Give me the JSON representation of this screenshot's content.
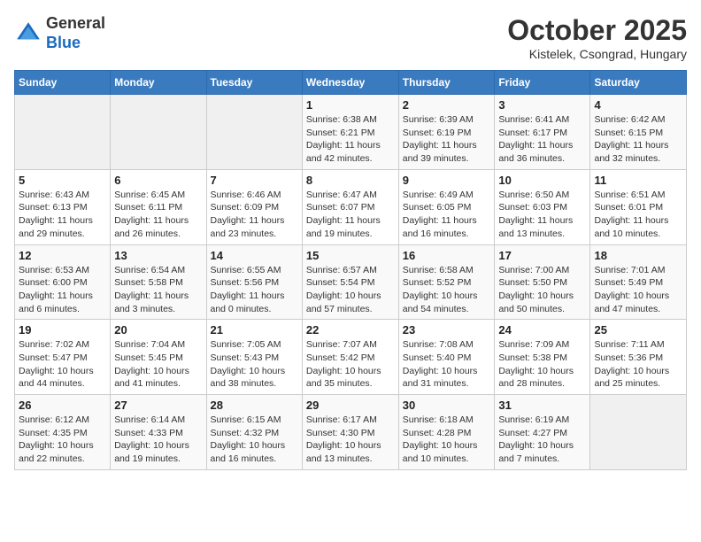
{
  "header": {
    "logo_line1": "General",
    "logo_line2": "Blue",
    "month_title": "October 2025",
    "location": "Kistelek, Csongrad, Hungary"
  },
  "weekdays": [
    "Sunday",
    "Monday",
    "Tuesday",
    "Wednesday",
    "Thursday",
    "Friday",
    "Saturday"
  ],
  "weeks": [
    [
      {
        "day": "",
        "info": ""
      },
      {
        "day": "",
        "info": ""
      },
      {
        "day": "",
        "info": ""
      },
      {
        "day": "1",
        "info": "Sunrise: 6:38 AM\nSunset: 6:21 PM\nDaylight: 11 hours\nand 42 minutes."
      },
      {
        "day": "2",
        "info": "Sunrise: 6:39 AM\nSunset: 6:19 PM\nDaylight: 11 hours\nand 39 minutes."
      },
      {
        "day": "3",
        "info": "Sunrise: 6:41 AM\nSunset: 6:17 PM\nDaylight: 11 hours\nand 36 minutes."
      },
      {
        "day": "4",
        "info": "Sunrise: 6:42 AM\nSunset: 6:15 PM\nDaylight: 11 hours\nand 32 minutes."
      }
    ],
    [
      {
        "day": "5",
        "info": "Sunrise: 6:43 AM\nSunset: 6:13 PM\nDaylight: 11 hours\nand 29 minutes."
      },
      {
        "day": "6",
        "info": "Sunrise: 6:45 AM\nSunset: 6:11 PM\nDaylight: 11 hours\nand 26 minutes."
      },
      {
        "day": "7",
        "info": "Sunrise: 6:46 AM\nSunset: 6:09 PM\nDaylight: 11 hours\nand 23 minutes."
      },
      {
        "day": "8",
        "info": "Sunrise: 6:47 AM\nSunset: 6:07 PM\nDaylight: 11 hours\nand 19 minutes."
      },
      {
        "day": "9",
        "info": "Sunrise: 6:49 AM\nSunset: 6:05 PM\nDaylight: 11 hours\nand 16 minutes."
      },
      {
        "day": "10",
        "info": "Sunrise: 6:50 AM\nSunset: 6:03 PM\nDaylight: 11 hours\nand 13 minutes."
      },
      {
        "day": "11",
        "info": "Sunrise: 6:51 AM\nSunset: 6:01 PM\nDaylight: 11 hours\nand 10 minutes."
      }
    ],
    [
      {
        "day": "12",
        "info": "Sunrise: 6:53 AM\nSunset: 6:00 PM\nDaylight: 11 hours\nand 6 minutes."
      },
      {
        "day": "13",
        "info": "Sunrise: 6:54 AM\nSunset: 5:58 PM\nDaylight: 11 hours\nand 3 minutes."
      },
      {
        "day": "14",
        "info": "Sunrise: 6:55 AM\nSunset: 5:56 PM\nDaylight: 11 hours\nand 0 minutes."
      },
      {
        "day": "15",
        "info": "Sunrise: 6:57 AM\nSunset: 5:54 PM\nDaylight: 10 hours\nand 57 minutes."
      },
      {
        "day": "16",
        "info": "Sunrise: 6:58 AM\nSunset: 5:52 PM\nDaylight: 10 hours\nand 54 minutes."
      },
      {
        "day": "17",
        "info": "Sunrise: 7:00 AM\nSunset: 5:50 PM\nDaylight: 10 hours\nand 50 minutes."
      },
      {
        "day": "18",
        "info": "Sunrise: 7:01 AM\nSunset: 5:49 PM\nDaylight: 10 hours\nand 47 minutes."
      }
    ],
    [
      {
        "day": "19",
        "info": "Sunrise: 7:02 AM\nSunset: 5:47 PM\nDaylight: 10 hours\nand 44 minutes."
      },
      {
        "day": "20",
        "info": "Sunrise: 7:04 AM\nSunset: 5:45 PM\nDaylight: 10 hours\nand 41 minutes."
      },
      {
        "day": "21",
        "info": "Sunrise: 7:05 AM\nSunset: 5:43 PM\nDaylight: 10 hours\nand 38 minutes."
      },
      {
        "day": "22",
        "info": "Sunrise: 7:07 AM\nSunset: 5:42 PM\nDaylight: 10 hours\nand 35 minutes."
      },
      {
        "day": "23",
        "info": "Sunrise: 7:08 AM\nSunset: 5:40 PM\nDaylight: 10 hours\nand 31 minutes."
      },
      {
        "day": "24",
        "info": "Sunrise: 7:09 AM\nSunset: 5:38 PM\nDaylight: 10 hours\nand 28 minutes."
      },
      {
        "day": "25",
        "info": "Sunrise: 7:11 AM\nSunset: 5:36 PM\nDaylight: 10 hours\nand 25 minutes."
      }
    ],
    [
      {
        "day": "26",
        "info": "Sunrise: 6:12 AM\nSunset: 4:35 PM\nDaylight: 10 hours\nand 22 minutes."
      },
      {
        "day": "27",
        "info": "Sunrise: 6:14 AM\nSunset: 4:33 PM\nDaylight: 10 hours\nand 19 minutes."
      },
      {
        "day": "28",
        "info": "Sunrise: 6:15 AM\nSunset: 4:32 PM\nDaylight: 10 hours\nand 16 minutes."
      },
      {
        "day": "29",
        "info": "Sunrise: 6:17 AM\nSunset: 4:30 PM\nDaylight: 10 hours\nand 13 minutes."
      },
      {
        "day": "30",
        "info": "Sunrise: 6:18 AM\nSunset: 4:28 PM\nDaylight: 10 hours\nand 10 minutes."
      },
      {
        "day": "31",
        "info": "Sunrise: 6:19 AM\nSunset: 4:27 PM\nDaylight: 10 hours\nand 7 minutes."
      },
      {
        "day": "",
        "info": ""
      }
    ]
  ]
}
